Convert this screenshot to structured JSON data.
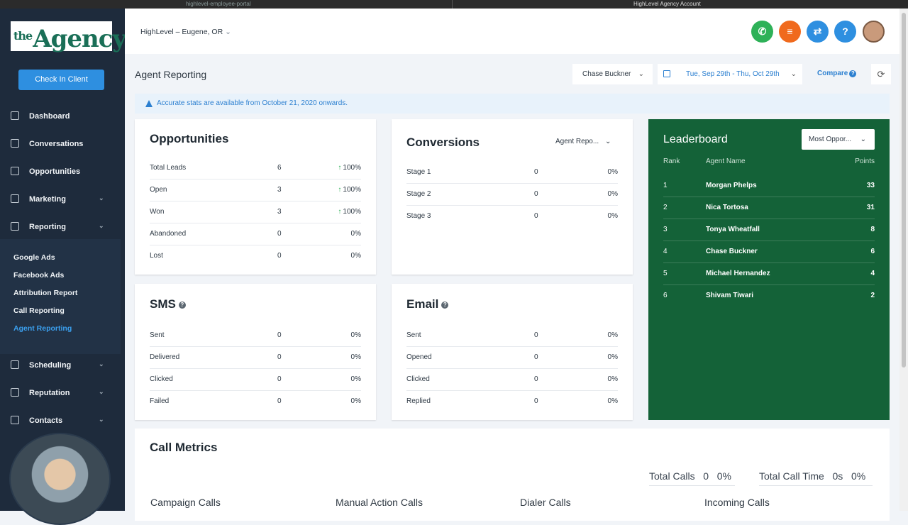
{
  "browser": {
    "tab_left": "highlevel-employee-portal",
    "tab_right": "HighLevel Agency Account"
  },
  "brand": {
    "logo_prefix": "the",
    "logo_main": "Agency",
    "accent": "#2e8fe0",
    "leader_bg": "#146238"
  },
  "sidebar": {
    "checkin_label": "Check In Client",
    "items": [
      {
        "label": "Dashboard",
        "icon": "dashboard-icon"
      },
      {
        "label": "Conversations",
        "icon": "chat-icon"
      },
      {
        "label": "Opportunities",
        "icon": "list-icon"
      },
      {
        "label": "Marketing",
        "icon": "mail-icon",
        "chevron": "⌄"
      },
      {
        "label": "Reporting",
        "icon": "chart-icon",
        "chevron": "⌄"
      },
      {
        "label": "Scheduling",
        "icon": "calendar-icon",
        "chevron": "⌄"
      },
      {
        "label": "Reputation",
        "icon": "star-icon",
        "chevron": "⌄"
      },
      {
        "label": "Contacts",
        "icon": "user-icon",
        "chevron": "⌄"
      }
    ],
    "subitems": [
      "Google Ads",
      "Facebook Ads",
      "Attribution Report",
      "Call Reporting",
      "Agent Reporting"
    ]
  },
  "header": {
    "location": "HighLevel – Eugene, OR",
    "chevron": "⌄",
    "help_glyph": "?"
  },
  "page": {
    "title": "Agent Reporting",
    "agent_filter": "Chase Buckner",
    "date_range": "Tue, Sep 29th - Thu, Oct 29th",
    "compare_label": "Compare",
    "alert": "Accurate stats are available from October 21, 2020 onwards."
  },
  "opportunities": {
    "title": "Opportunities",
    "rows": [
      {
        "label": "Total Leads",
        "value": "6",
        "pct": "100%",
        "up": true
      },
      {
        "label": "Open",
        "value": "3",
        "pct": "100%",
        "up": true
      },
      {
        "label": "Won",
        "value": "3",
        "pct": "100%",
        "up": true
      },
      {
        "label": "Abandoned",
        "value": "0",
        "pct": "0%",
        "up": false
      },
      {
        "label": "Lost",
        "value": "0",
        "pct": "0%",
        "up": false
      }
    ]
  },
  "conversions": {
    "title": "Conversions",
    "filter": "Agent Repo...",
    "rows": [
      {
        "label": "Stage 1",
        "value": "0",
        "pct": "0%"
      },
      {
        "label": "Stage 2",
        "value": "0",
        "pct": "0%"
      },
      {
        "label": "Stage 3",
        "value": "0",
        "pct": "0%"
      }
    ]
  },
  "sms": {
    "title": "SMS",
    "rows": [
      {
        "label": "Sent",
        "value": "0",
        "pct": "0%"
      },
      {
        "label": "Delivered",
        "value": "0",
        "pct": "0%"
      },
      {
        "label": "Clicked",
        "value": "0",
        "pct": "0%"
      },
      {
        "label": "Failed",
        "value": "0",
        "pct": "0%"
      }
    ]
  },
  "email": {
    "title": "Email",
    "rows": [
      {
        "label": "Sent",
        "value": "0",
        "pct": "0%"
      },
      {
        "label": "Opened",
        "value": "0",
        "pct": "0%"
      },
      {
        "label": "Clicked",
        "value": "0",
        "pct": "0%"
      },
      {
        "label": "Replied",
        "value": "0",
        "pct": "0%"
      }
    ]
  },
  "leaderboard": {
    "title": "Leaderboard",
    "filter": "Most Oppor...",
    "headers": {
      "rank": "Rank",
      "name": "Agent Name",
      "points": "Points"
    },
    "rows": [
      {
        "rank": "1",
        "name": "Morgan Phelps",
        "points": "33"
      },
      {
        "rank": "2",
        "name": "Nica Tortosa",
        "points": "31"
      },
      {
        "rank": "3",
        "name": "Tonya Wheatfall",
        "points": "8"
      },
      {
        "rank": "4",
        "name": "Chase Buckner",
        "points": "6"
      },
      {
        "rank": "5",
        "name": "Michael Hernandez",
        "points": "4"
      },
      {
        "rank": "6",
        "name": "Shivam Tiwari",
        "points": "2"
      }
    ]
  },
  "call_metrics": {
    "title": "Call Metrics",
    "total_calls_label": "Total Calls",
    "total_calls_value": "0",
    "total_calls_pct": "0%",
    "total_time_label": "Total Call Time",
    "total_time_value": "0s",
    "total_time_pct": "0%",
    "columns": [
      "Campaign Calls",
      "Manual Action Calls",
      "Dialer Calls",
      "Incoming Calls"
    ]
  }
}
